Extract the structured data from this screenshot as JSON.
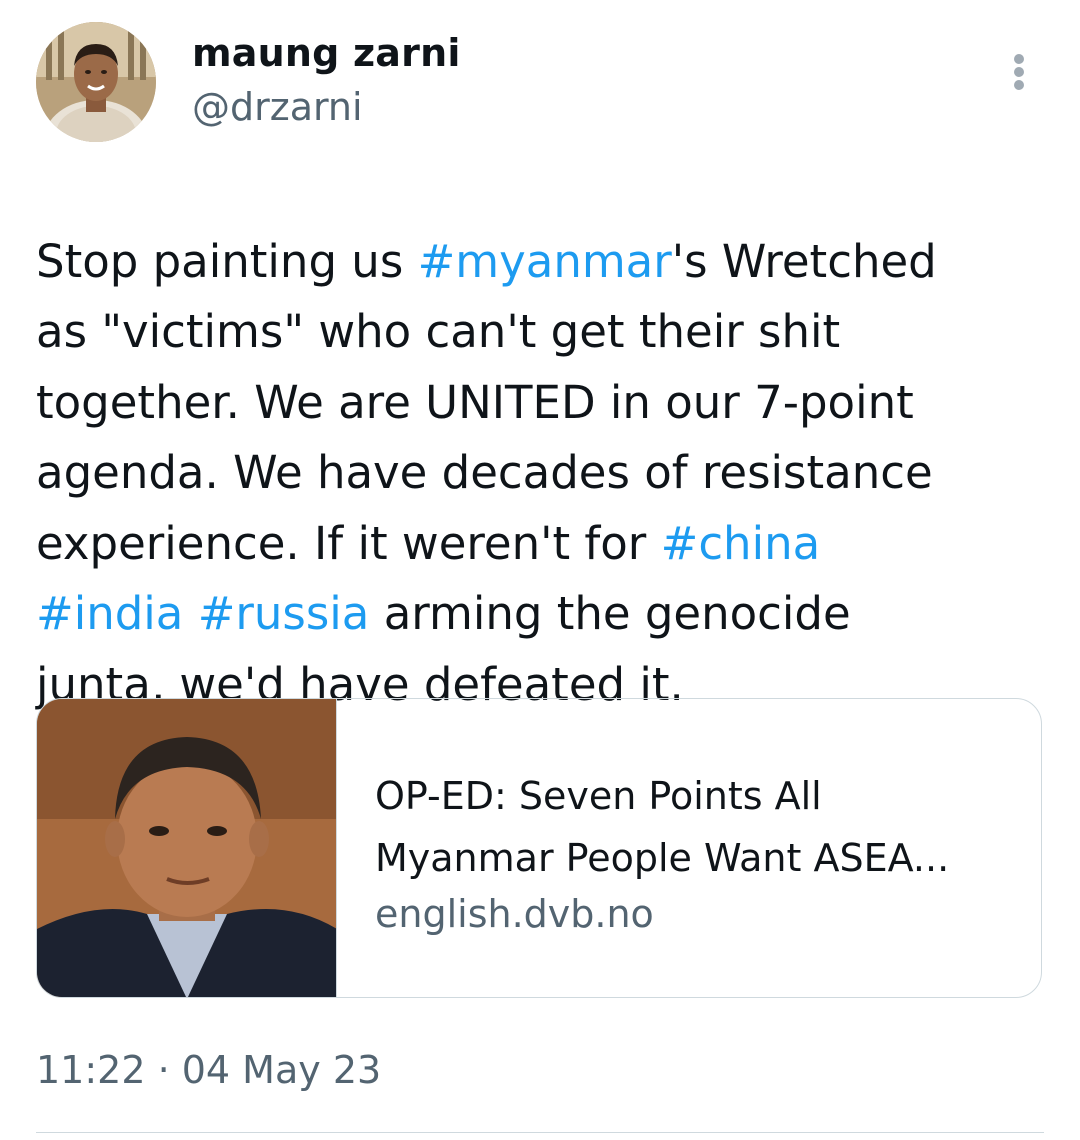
{
  "author": {
    "name": "maung zarni",
    "handle": "@drzarni"
  },
  "tweet": {
    "segments": [
      {
        "text": "Stop painting us ",
        "hashtag": false
      },
      {
        "text": "#myanmar",
        "hashtag": true
      },
      {
        "text": "'s Wretched\nas \"victims\" who can't get their shit\ntogether.  We are UNITED in our 7-point\nagenda.  We have decades of resistance\nexperience. If it weren't for ",
        "hashtag": false
      },
      {
        "text": "#china",
        "hashtag": true
      },
      {
        "text": "\n",
        "hashtag": false
      },
      {
        "text": "#india",
        "hashtag": true
      },
      {
        "text": " ",
        "hashtag": false
      },
      {
        "text": "#russia",
        "hashtag": true
      },
      {
        "text": " arming the genocide\njunta, we'd have defeated it.",
        "hashtag": false
      }
    ]
  },
  "link_card": {
    "title": "OP-ED: Seven Points All\nMyanmar People Want ASEA...",
    "domain": "english.dvb.no"
  },
  "timestamp": "11:22 · 04 May 23",
  "colors": {
    "text": "#0f1419",
    "secondary": "#536471",
    "link": "#1d9bf0",
    "border": "#cfd9de"
  },
  "icons": {
    "more": "more-vertical-icon"
  }
}
